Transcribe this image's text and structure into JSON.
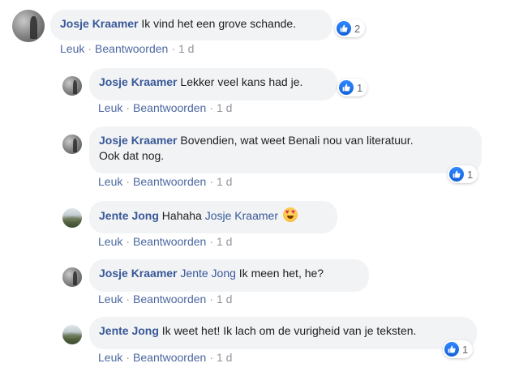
{
  "actions": {
    "like": "Leuk",
    "reply": "Beantwoorden",
    "time": "1 d"
  },
  "colors": {
    "author": "#385898",
    "bubble": "#f2f3f5",
    "like_blue": "#1877f2"
  },
  "comments": [
    {
      "author": "Josje Kraamer",
      "text": "Ik vind het een grove schande.",
      "reaction_count": "2",
      "avatar_icon": "josje-avatar"
    }
  ],
  "replies": [
    {
      "author": "Josje Kraamer",
      "text": "Lekker veel kans had je.",
      "reaction_count": "1"
    },
    {
      "author": "Josje Kraamer",
      "text_line1": "Bovendien, wat weet Benali nou van literatuur.",
      "text_line2": "Ook dat nog.",
      "reaction_count": "1"
    },
    {
      "author": "Jente Jong",
      "text": "Hahaha",
      "mention": "Josje Kraamer",
      "emoji": "heart-eyes-emoji"
    },
    {
      "author": "Josje Kraamer",
      "mention": "Jente Jong",
      "text": "Ik meen het, he?"
    },
    {
      "author": "Jente Jong",
      "text": "Ik weet het! Ik lach om de vurigheid van je teksten.",
      "reaction_count": "1"
    }
  ]
}
